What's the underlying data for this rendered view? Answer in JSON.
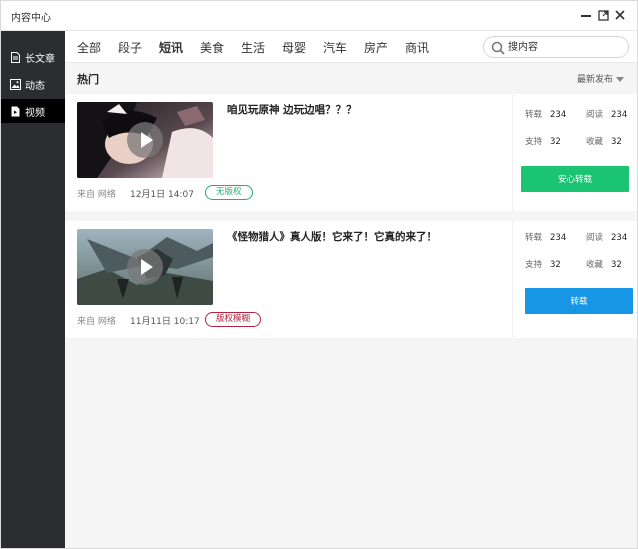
{
  "window": {
    "title": "内容中心",
    "controls": [
      "minimize-icon",
      "maximize-icon",
      "close-icon"
    ]
  },
  "sidebar": {
    "items": [
      {
        "label": "长文章",
        "icon": "document-icon",
        "active": false
      },
      {
        "label": "动态",
        "icon": "image-icon",
        "active": false
      },
      {
        "label": "视频",
        "icon": "video-icon",
        "active": true
      }
    ]
  },
  "topnav": {
    "tabs": [
      {
        "label": "全部",
        "bold": false
      },
      {
        "label": "段子",
        "bold": false
      },
      {
        "label": "短讯",
        "bold": true
      },
      {
        "label": "美食",
        "bold": false
      },
      {
        "label": "生活",
        "bold": false
      },
      {
        "label": "母婴",
        "bold": false
      },
      {
        "label": "汽车",
        "bold": false
      },
      {
        "label": "房产",
        "bold": false
      },
      {
        "label": "商讯",
        "bold": false
      }
    ],
    "search": {
      "placeholder": "搜内容",
      "icon": "search-icon"
    }
  },
  "section": {
    "title": "热门",
    "sort_label": "最新发布"
  },
  "cards": [
    {
      "title": "咱见玩原神 边玩边唱？？？",
      "source": "来自 网络",
      "date": "12月1日 14:07",
      "badge": "无版权",
      "badge_color": "#23b26d",
      "stats": {
        "repost_label": "转载",
        "repost": "234",
        "read_label": "阅读",
        "read": "234",
        "support_label": "支持",
        "support": "32",
        "fav_label": "收藏",
        "fav": "32"
      },
      "action": "安心转载",
      "action_color": "#1bc472"
    },
    {
      "title": "《怪物猎人》真人版！它来了！它真的来了！",
      "source": "来自 网络",
      "date": "11月11日 10:17",
      "badge": "版权模糊",
      "badge_color": "#b3223f",
      "stats": {
        "repost_label": "转载",
        "repost": "234",
        "read_label": "阅读",
        "read": "234",
        "support_label": "支持",
        "support": "32",
        "fav_label": "收藏",
        "fav": "32"
      },
      "action": "转载",
      "action_color": "#1796e6"
    }
  ]
}
